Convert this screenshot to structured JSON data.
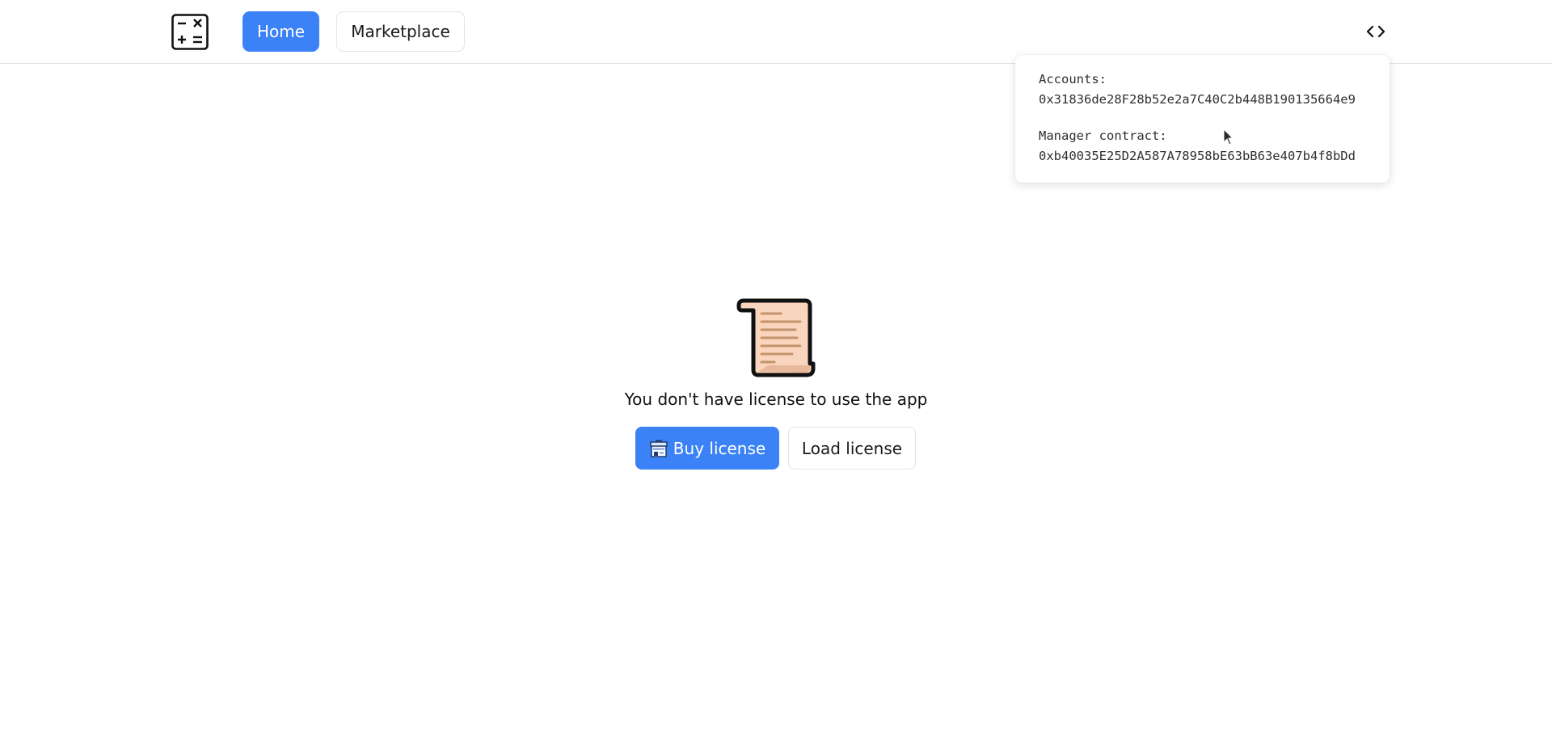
{
  "navbar": {
    "logo_icon": "calculator-icon",
    "items": [
      {
        "label": "Home",
        "active": true
      },
      {
        "label": "Marketplace",
        "active": false
      }
    ],
    "code_toggle_icon": "code-icon"
  },
  "popover": {
    "accounts_label": "Accounts:",
    "accounts_value": "0x31836de28F28b52e2a7C40C2b448B190135664e9",
    "manager_label": "Manager contract:",
    "manager_value": "0xb40035E25D2A587A78958bE63bB63e407b4f8bDd"
  },
  "main": {
    "icon": "scroll-icon",
    "message": "You don't have license to use the app",
    "buy_button": {
      "label": "Buy license",
      "icon": "store-icon"
    },
    "load_button": {
      "label": "Load license"
    }
  },
  "colors": {
    "primary": "#3b82f6",
    "scroll_fill": "#f9d5bd",
    "scroll_lines": "#c4936e"
  }
}
